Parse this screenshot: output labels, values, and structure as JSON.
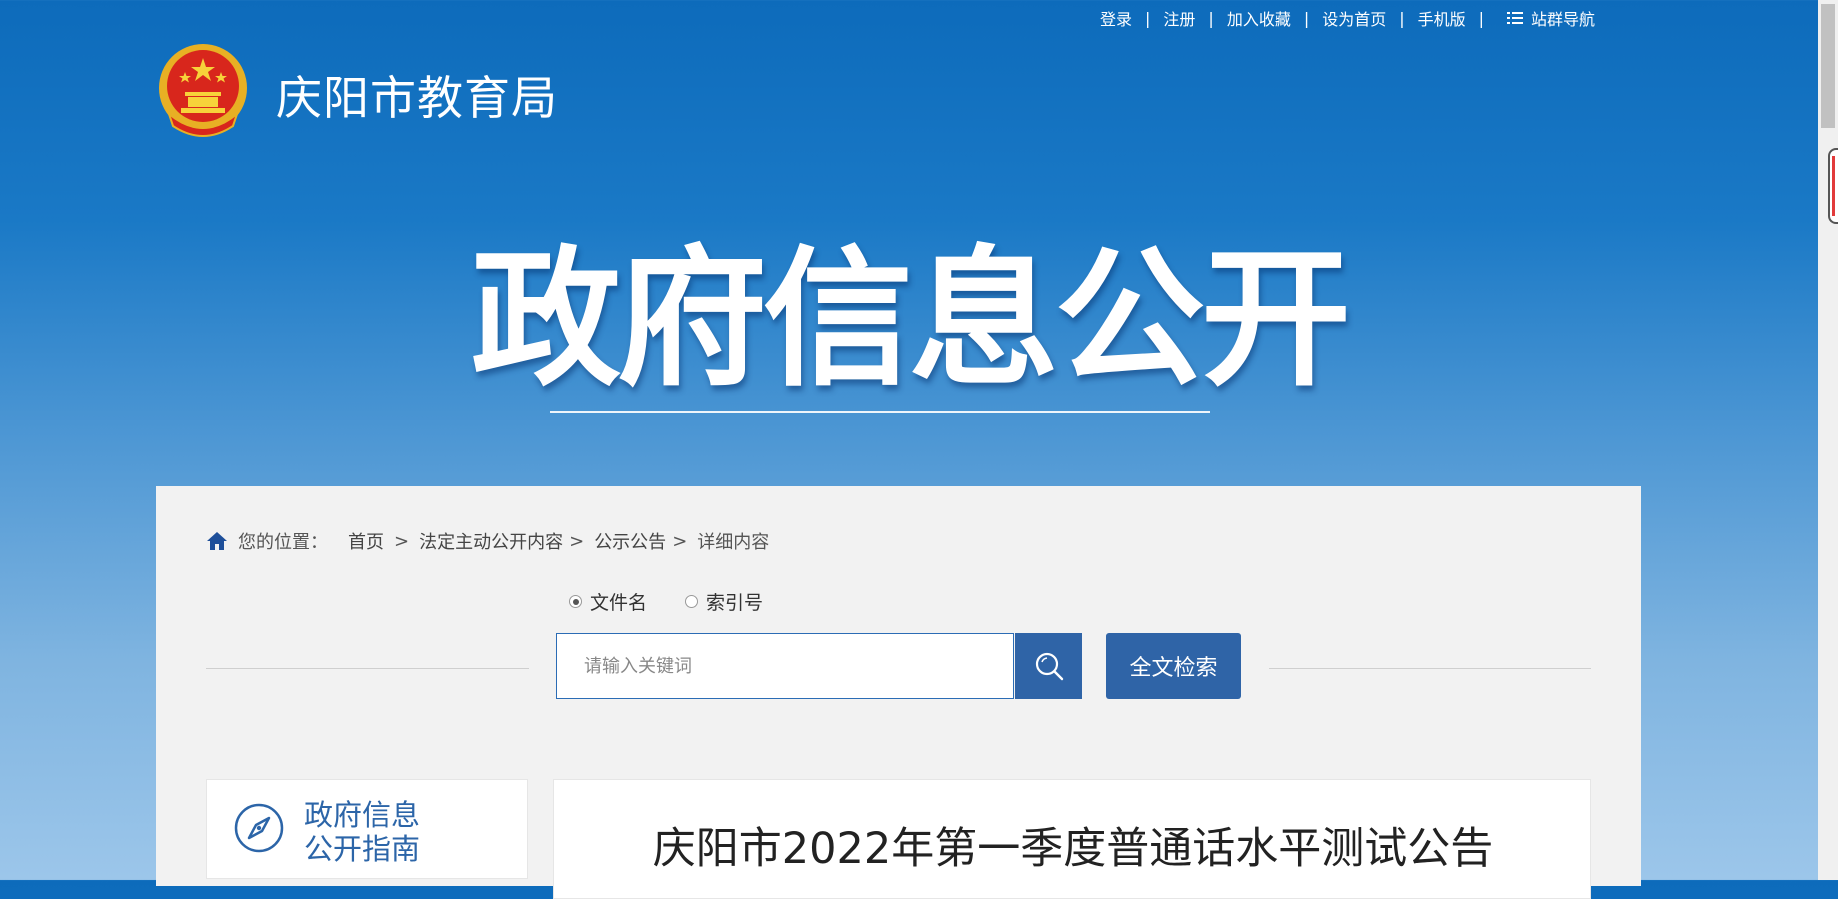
{
  "topbar": {
    "links": [
      "登录",
      "注册",
      "加入收藏",
      "设为首页",
      "手机版"
    ],
    "sitemap_label": "站群导航"
  },
  "header": {
    "site_title": "庆阳市教育局"
  },
  "hero": {
    "title": "政府信息公开"
  },
  "breadcrumb": {
    "prefix": "您的位置：",
    "items": [
      "首页",
      "法定主动公开内容",
      "公示公告",
      "详细内容"
    ],
    "separator": ">"
  },
  "search": {
    "options": [
      {
        "label": "文件名",
        "selected": true
      },
      {
        "label": "索引号",
        "selected": false
      }
    ],
    "placeholder": "请输入关键词",
    "fulltext_label": "全文检索"
  },
  "guide": {
    "line1": "政府信息",
    "line2": "公开指南"
  },
  "article": {
    "title": "庆阳市2022年第一季度普通话水平测试公告"
  },
  "colors": {
    "primary": "#2f64a7",
    "banner_top": "#0d6bbb",
    "panel_bg": "#f2f2f2"
  }
}
